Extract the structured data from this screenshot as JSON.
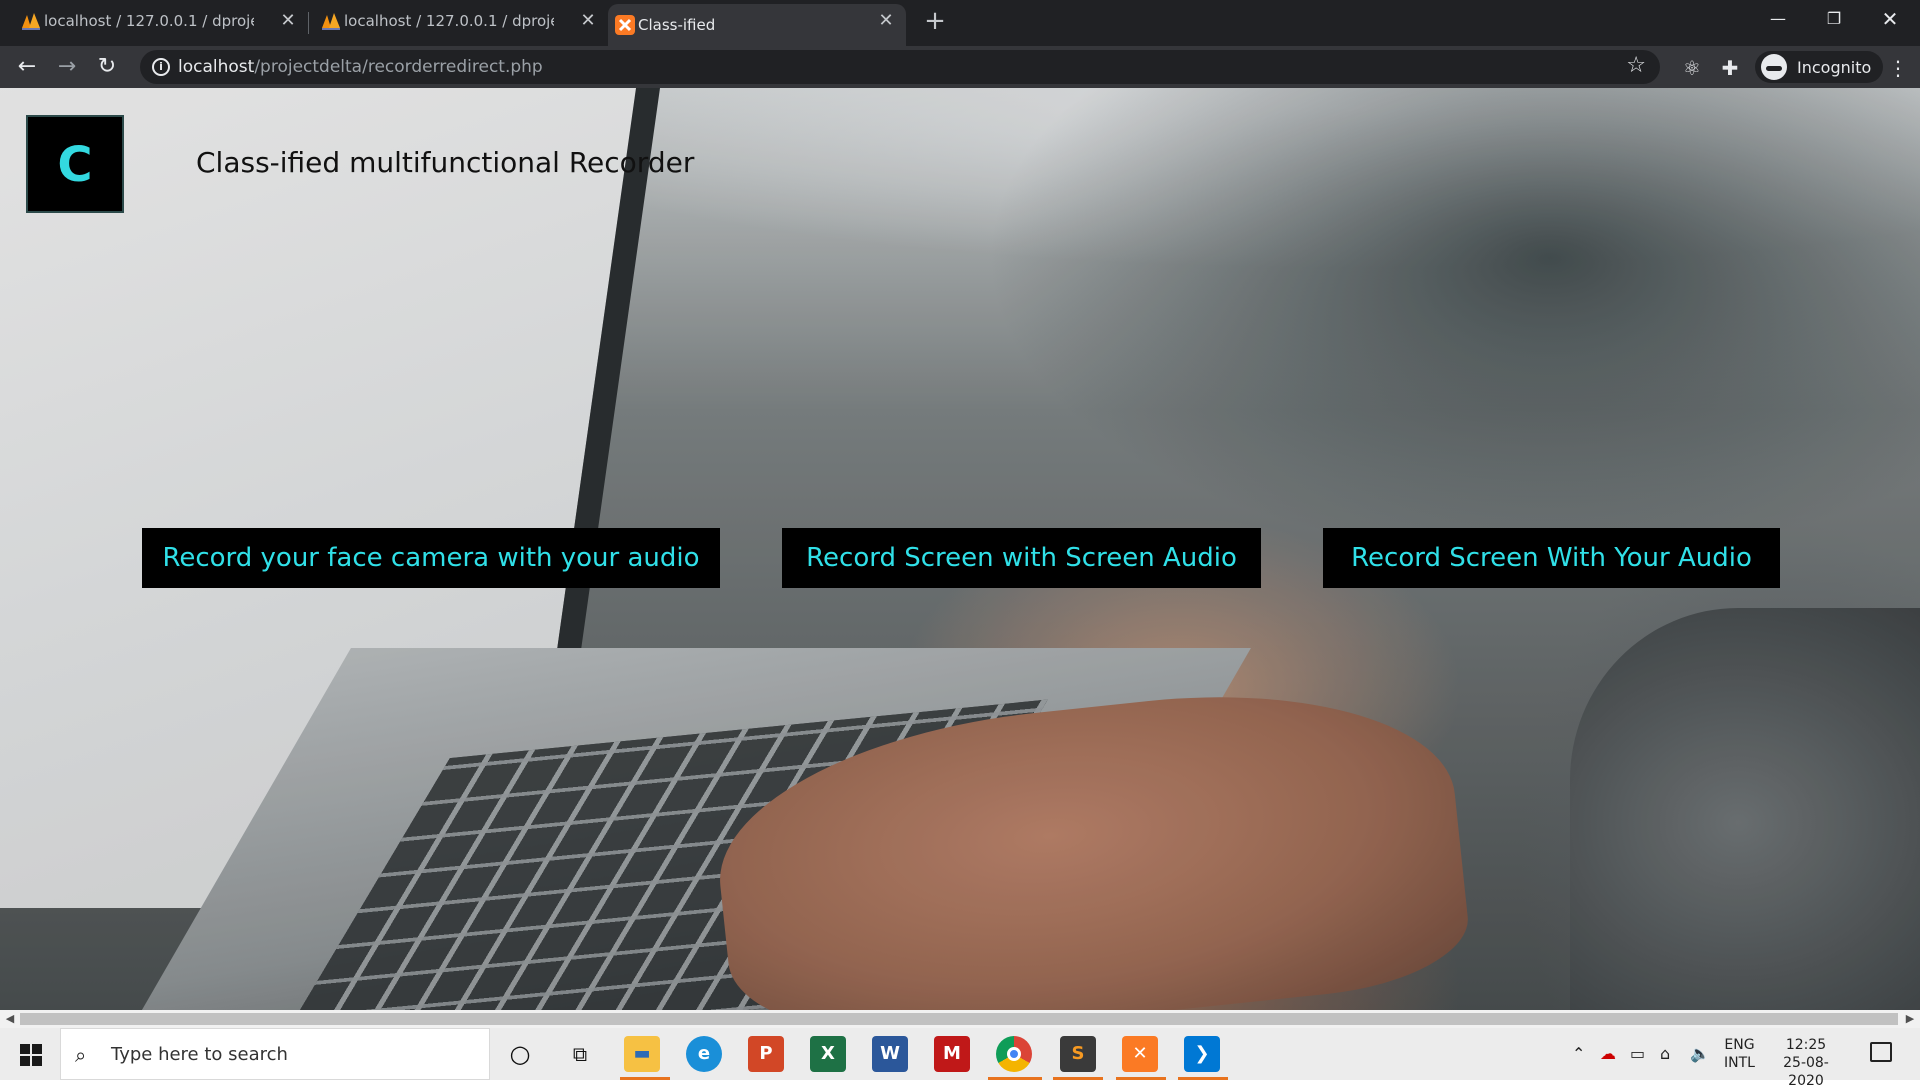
{
  "browser": {
    "tabs": [
      {
        "title": "localhost / 127.0.0.1 / dproject / ",
        "active": false
      },
      {
        "title": "localhost / 127.0.0.1 / dproject / ",
        "active": false
      },
      {
        "title": "Class-ified",
        "active": true
      }
    ],
    "url_host": "localhost",
    "url_path": "/projectdelta/recorderredirect.php",
    "profile_label": "Incognito"
  },
  "page": {
    "logo_letter": "C",
    "title": "Class-ified multifunctional Recorder",
    "buttons": [
      "Record your face camera with your audio",
      "Record Screen with Screen Audio",
      "Record Screen With Your Audio"
    ]
  },
  "taskbar": {
    "search_placeholder": "Type here to search",
    "lang_top": "ENG",
    "lang_bottom": "INTL",
    "time": "12:25",
    "date": "25-08-2020"
  },
  "colors": {
    "accent_cyan": "#30e0e8",
    "chrome_dark": "#202124",
    "toolbar": "#35363a"
  }
}
